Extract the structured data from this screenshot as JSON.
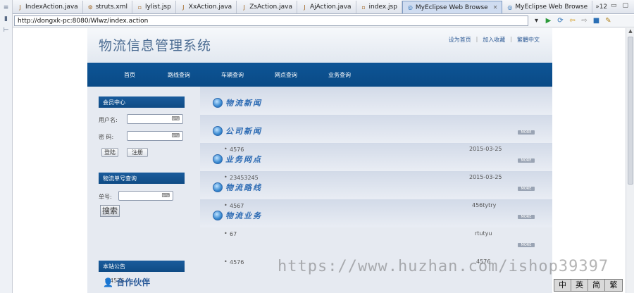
{
  "ide": {
    "tabs": [
      {
        "label": "IndexAction.java",
        "icon": "java-file-icon"
      },
      {
        "label": "struts.xml",
        "icon": "xml-gear-icon"
      },
      {
        "label": "lylist.jsp",
        "icon": "jsp-file-icon"
      },
      {
        "label": "XxAction.java",
        "icon": "java-file-icon"
      },
      {
        "label": "ZsAction.java",
        "icon": "java-file-icon"
      },
      {
        "label": "AjAction.java",
        "icon": "java-file-icon"
      },
      {
        "label": "index.jsp",
        "icon": "jsp-file-icon"
      },
      {
        "label": "MyEclipse Web Browse",
        "icon": "globe-icon",
        "active": true
      },
      {
        "label": "MyEclipse Web Browse",
        "icon": "globe-icon"
      }
    ],
    "tab_overflow": "»12",
    "url": "http://dongxk-pc:8080/Wlwz/index.action"
  },
  "site": {
    "title": "物流信息管理系统",
    "top_links": [
      "设为首页",
      "加入收藏",
      "繁體中文"
    ],
    "nav": [
      "首页",
      "路线查询",
      "车辆查询",
      "网点查询",
      "业务查询"
    ]
  },
  "member": {
    "title": "会员中心",
    "username_label": "用户名:",
    "password_label": "密  码:",
    "login_btn": "登陆",
    "register_btn": "注册"
  },
  "tracking": {
    "title": "物流单号查询",
    "label": "单号:",
    "search_btn": "搜索"
  },
  "notice": {
    "title": "本站公告",
    "items": [
      "4576"
    ]
  },
  "partner": {
    "title": "合作伙伴"
  },
  "sections": [
    {
      "title": "物流新闻",
      "item": "4576",
      "date": "2015-03-25"
    },
    {
      "title": "公司新闻",
      "item": "23453245",
      "date": "2015-03-25"
    },
    {
      "title": "业务网点",
      "item": "4567",
      "date": "456tytry"
    },
    {
      "title": "物流路线",
      "item": "67",
      "date": "rtutyu"
    },
    {
      "title": "物流业务",
      "item": "4576",
      "date": "4576"
    }
  ],
  "more_label": "MORE",
  "watermark": "https://www.huzhan.com/ishop39397",
  "ime": [
    "中",
    "英",
    "简",
    "繁"
  ]
}
